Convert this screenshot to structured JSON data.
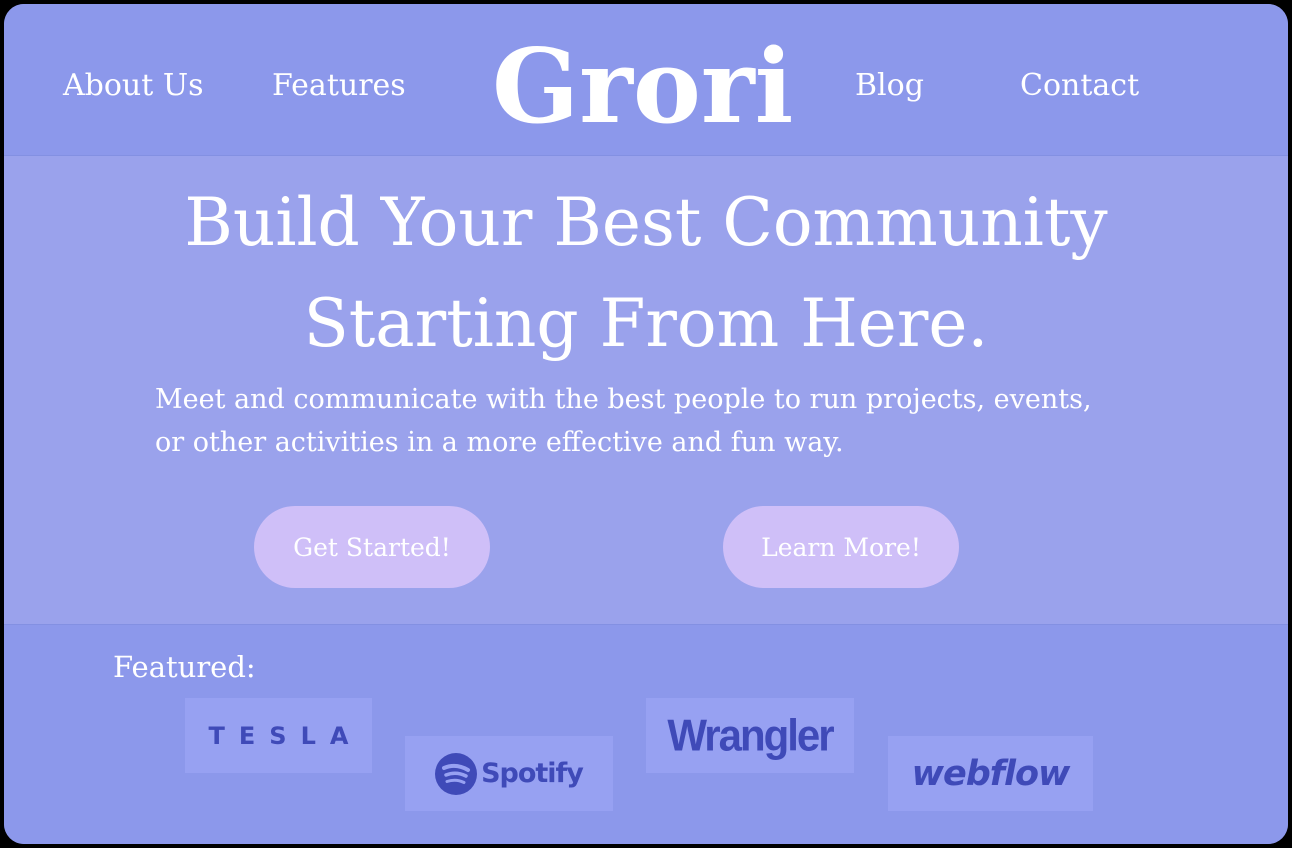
{
  "header": {
    "nav_left": [
      "About Us",
      "Features"
    ],
    "logo": "Grori",
    "nav_right": [
      "Blog",
      "Contact"
    ]
  },
  "hero": {
    "title_line1": "Build Your Best Community",
    "title_line2": "Starting From Here.",
    "subtitle_line1": "Meet and communicate with the best people to run projects, events,",
    "subtitle_line2": "or other activities in a more effective and fun way.",
    "primary_button": "Get Started!",
    "secondary_button": "Learn More!"
  },
  "featured": {
    "label": "Featured:",
    "logos": [
      {
        "name": "TESLA",
        "icon": "tesla-logo"
      },
      {
        "name": "Spotify",
        "icon": "spotify-logo"
      },
      {
        "name": "Wrangler",
        "icon": "wrangler-logo"
      },
      {
        "name": "webflow",
        "icon": "webflow-logo"
      }
    ]
  },
  "colors": {
    "header_bg": "#8c98eb",
    "hero_bg": "#9aa2ec",
    "button_bg": "#cfbff8",
    "logo_ink": "#3f4ab8",
    "text": "#ffffff"
  }
}
